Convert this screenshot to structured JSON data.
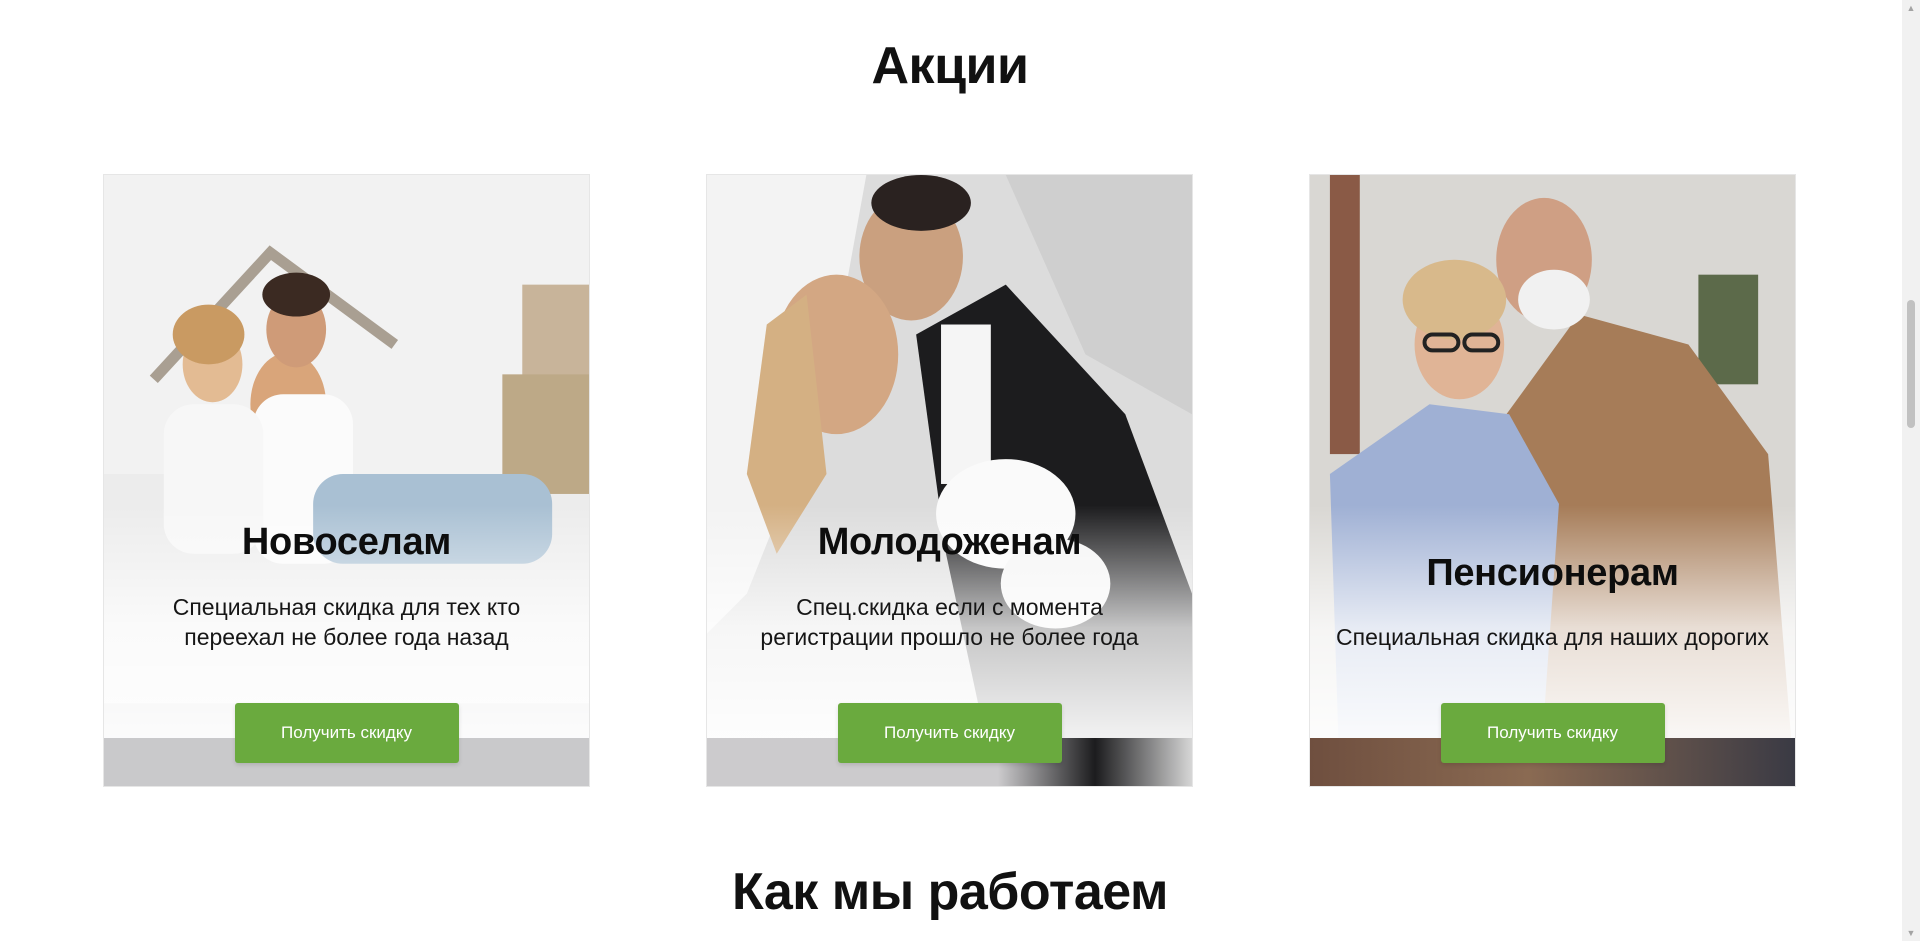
{
  "section_title": "Акции",
  "cards": [
    {
      "title": "Новоселам",
      "text": "Специальная скидка для тех кто переехал не более года назад",
      "button": "Получить скидку"
    },
    {
      "title": "Молодоженам",
      "text": "Спец.скидка если с момента регистрации прошло не более года",
      "button": "Получить скидку"
    },
    {
      "title": "Пенсионерам",
      "text": "Специальная скидка для наших дорогих",
      "button": "Получить скидку"
    }
  ],
  "next_section_title": "Как мы работаем",
  "colors": {
    "accent_button": "#6aaa3e",
    "heading": "#111111",
    "background": "#ffffff"
  },
  "icons": {
    "scroll_up": "triangle-up-icon",
    "scroll_down": "triangle-down-icon"
  }
}
